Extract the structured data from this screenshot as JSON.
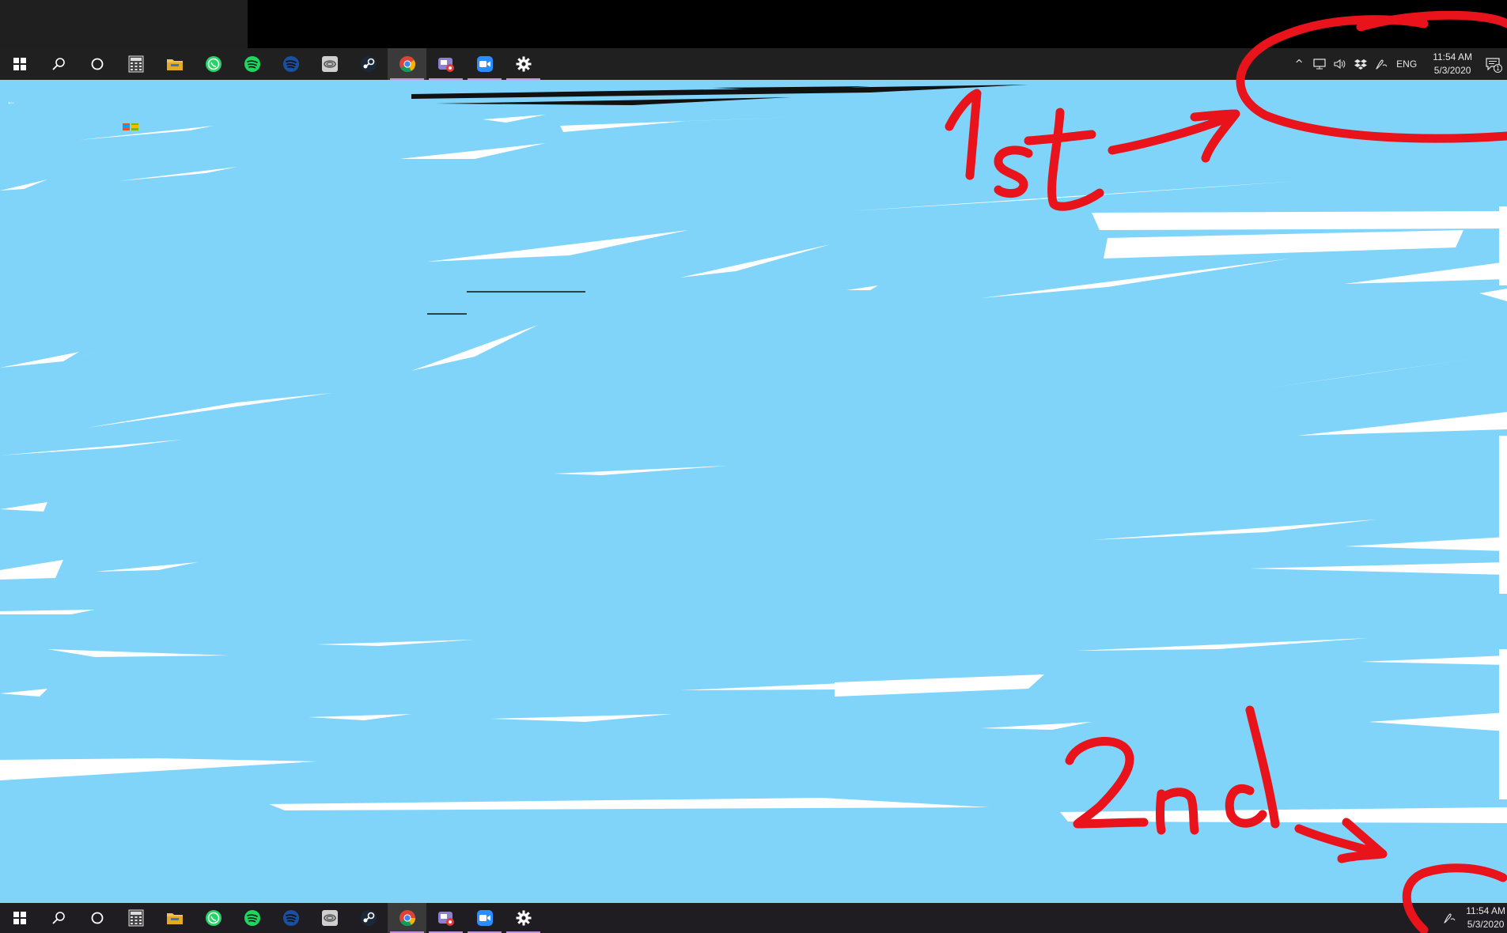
{
  "taskbar": {
    "apps": [
      {
        "name": "start-icon",
        "state": "normal"
      },
      {
        "name": "search-icon",
        "state": "normal"
      },
      {
        "name": "cortana-icon",
        "state": "normal"
      },
      {
        "name": "calculator-icon",
        "state": "normal"
      },
      {
        "name": "file-explorer-icon",
        "state": "normal"
      },
      {
        "name": "whatsapp-icon",
        "state": "normal"
      },
      {
        "name": "spotify-icon",
        "state": "normal"
      },
      {
        "name": "spotify-alt-icon",
        "state": "normal"
      },
      {
        "name": "app-swirl-icon",
        "state": "normal"
      },
      {
        "name": "steam-icon",
        "state": "normal"
      },
      {
        "name": "chrome-icon",
        "state": "active"
      },
      {
        "name": "recorder-icon",
        "state": "running"
      },
      {
        "name": "zoom-icon",
        "state": "running"
      },
      {
        "name": "settings-icon",
        "state": "running"
      }
    ],
    "tray": {
      "language": "ENG",
      "time": "11:54 AM",
      "date": "5/3/2020",
      "notifications": "1"
    }
  },
  "annotations": {
    "first_label": "1st",
    "second_label": "2nd",
    "ink_color": "#e8131b"
  },
  "colors": {
    "scribble": "#80d4fa",
    "taskbar": "#202020",
    "accent_running": "#c58fe0"
  }
}
